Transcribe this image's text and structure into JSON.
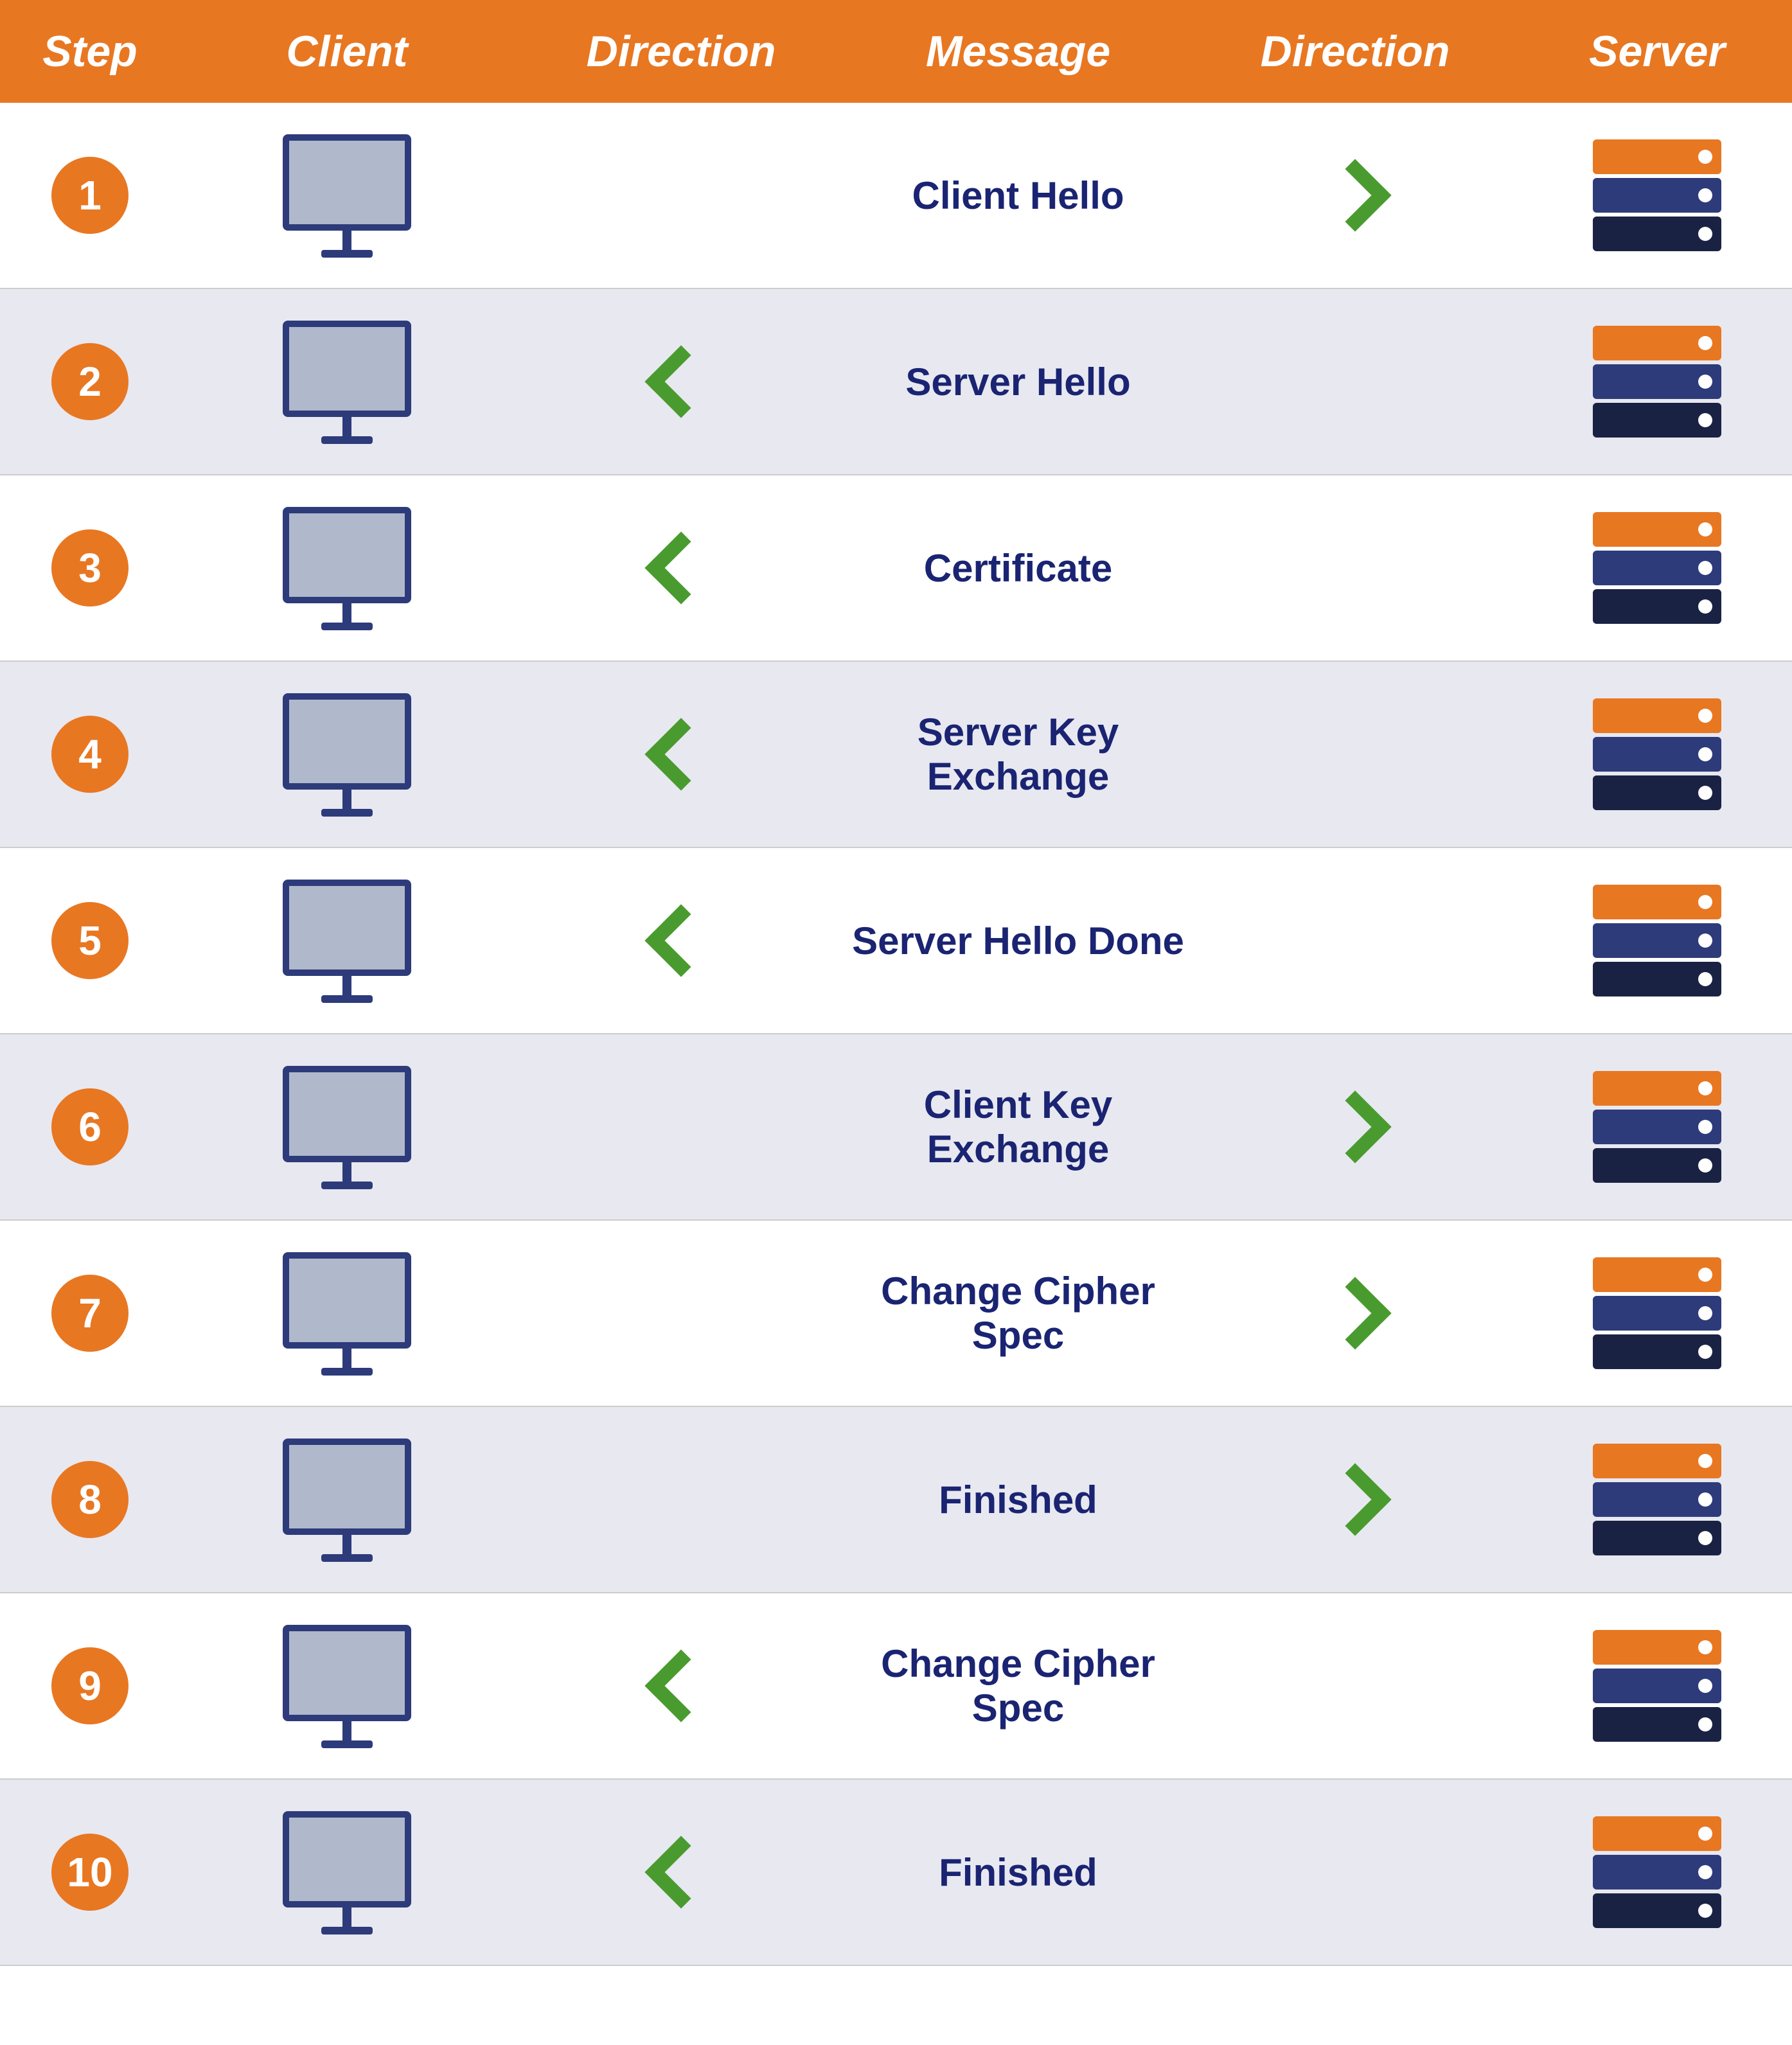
{
  "header": {
    "step": "Step",
    "client": "Client",
    "direction1": "Direction",
    "message": "Message",
    "direction2": "Direction",
    "server": "Server"
  },
  "rows": [
    {
      "step": "1",
      "message": "Client Hello",
      "dir_client": "",
      "dir_server": "right"
    },
    {
      "step": "2",
      "message": "Server Hello",
      "dir_client": "left",
      "dir_server": ""
    },
    {
      "step": "3",
      "message": "Certificate",
      "dir_client": "left",
      "dir_server": ""
    },
    {
      "step": "4",
      "message": "Server Key Exchange",
      "dir_client": "left",
      "dir_server": ""
    },
    {
      "step": "5",
      "message": "Server Hello Done",
      "dir_client": "left",
      "dir_server": ""
    },
    {
      "step": "6",
      "message": "Client Key Exchange",
      "dir_client": "",
      "dir_server": "right"
    },
    {
      "step": "7",
      "message": "Change Cipher Spec",
      "dir_client": "",
      "dir_server": "right"
    },
    {
      "step": "8",
      "message": "Finished",
      "dir_client": "",
      "dir_server": "right"
    },
    {
      "step": "9",
      "message": "Change Cipher Spec",
      "dir_client": "left",
      "dir_server": ""
    },
    {
      "step": "10",
      "message": "Finished",
      "dir_client": "left",
      "dir_server": ""
    }
  ]
}
